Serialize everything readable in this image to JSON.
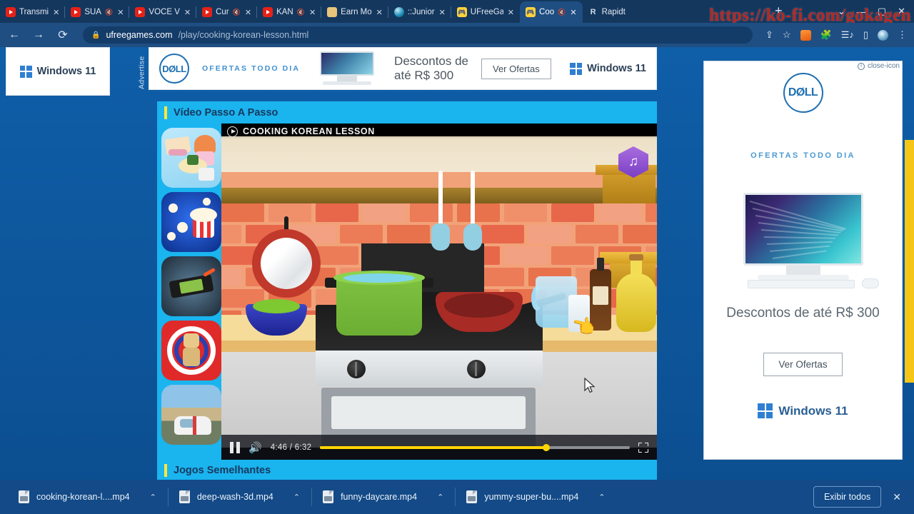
{
  "browser": {
    "tabs": [
      {
        "title": "Transmi",
        "favicon": "youtube-icon",
        "muted": false,
        "active": false
      },
      {
        "title": "SUA",
        "favicon": "youtube-icon",
        "muted": true,
        "active": false
      },
      {
        "title": "VOCÊ V",
        "favicon": "youtube-icon",
        "muted": false,
        "active": false
      },
      {
        "title": "Cur",
        "favicon": "youtube-icon",
        "muted": true,
        "active": false
      },
      {
        "title": "KAN",
        "favicon": "youtube-icon",
        "muted": true,
        "active": false
      },
      {
        "title": "Earn Mo",
        "favicon": "book-icon",
        "muted": false,
        "active": false
      },
      {
        "title": "::Junior",
        "favicon": "globe-icon",
        "muted": false,
        "active": false
      },
      {
        "title": "UFreeGa",
        "favicon": "game-icon",
        "muted": false,
        "active": false
      },
      {
        "title": "Coo",
        "favicon": "game-icon",
        "muted": true,
        "active": true
      },
      {
        "title": "Rapidt",
        "favicon": "r-icon",
        "muted": false,
        "active": false
      }
    ],
    "new_tab_label": "+",
    "window_controls": {
      "minimize": "—",
      "maximize": "▢",
      "close": "✕",
      "chevron": "⌄"
    },
    "nav": {
      "back": "←",
      "forward": "→",
      "reload": "⟳"
    },
    "address": {
      "lock": "🔒",
      "domain": "ufreegames.com",
      "path": "/play/cooking-korean-lesson.html",
      "full": "ufreegames.com/play/cooking-korean-lesson.html"
    },
    "toolbar_icons": [
      "share-icon",
      "bookmark-star-icon",
      "fox-extension-icon",
      "puzzle-extension-icon",
      "reading-list-icon",
      "side-panel-icon",
      "profile-avatar-icon",
      "three-dot-menu-icon"
    ]
  },
  "watermark": {
    "text": "https://ko-fi.com/gokagen"
  },
  "left_ad": {
    "windows_label": "Windows 11"
  },
  "advertise_tab": {
    "label": "Advertise"
  },
  "top_banner": {
    "brand": "DØLL",
    "tagline": "OFERTAS TODO DIA",
    "headline_line1": "Descontos de",
    "headline_line2": "até R$ 300",
    "cta": "Ver Ofertas",
    "windows_label": "Windows 11"
  },
  "sections": {
    "video_header": "Vídeo Passo A Passo",
    "similar_header": "Jogos Semelhantes"
  },
  "thumbnails": [
    {
      "name": "cake-dessert-game-thumb"
    },
    {
      "name": "popcorn-game-thumb"
    },
    {
      "name": "car-crash-game-thumb"
    },
    {
      "name": "kick-the-buddy-game-thumb"
    },
    {
      "name": "racing-car-game-thumb"
    }
  ],
  "player": {
    "title": "COOKING KOREAN LESSON",
    "current_time": "4:46",
    "duration": "6:32",
    "time_display": "4:46 / 6:32",
    "progress_percent": 73,
    "state": "playing",
    "pause_label": "Pause",
    "volume_icon": "volume-on-icon",
    "fullscreen_icon": "fullscreen-icon",
    "music_badge_icon": "music-note-icon",
    "scene": {
      "items": [
        "hanging-pan",
        "spatula",
        "spoon",
        "green-pot",
        "red-skillet",
        "blue-bowl",
        "water-jug",
        "soy-sauce-bottle",
        "oil-jug",
        "salt-shaker",
        "stove",
        "brick-wall",
        "wooden-shelf"
      ]
    }
  },
  "right_ad": {
    "brand": "DØLL",
    "tagline": "OFERTAS TODO DIA",
    "headline": "Descontos de até R$ 300",
    "cta": "Ver Ofertas",
    "windows_label": "Windows 11",
    "adchoices_icon": "info-icon",
    "close_icon": "close-icon"
  },
  "downloads": {
    "items": [
      {
        "filename": "cooking-korean-l....mp4"
      },
      {
        "filename": "deep-wash-3d.mp4"
      },
      {
        "filename": "funny-daycare.mp4"
      },
      {
        "filename": "yummy-super-bu....mp4"
      }
    ],
    "caret": "⌃",
    "show_all": "Exibir todos",
    "close": "✕"
  },
  "colors": {
    "page_blue": "#0f5ea8",
    "section_cyan": "#1ab4ef",
    "accent_yellow": "#ffe83d",
    "progress_yellow": "#ffd400",
    "browser_chrome": "#1f4e82",
    "watermark_red": "#b9271f"
  }
}
